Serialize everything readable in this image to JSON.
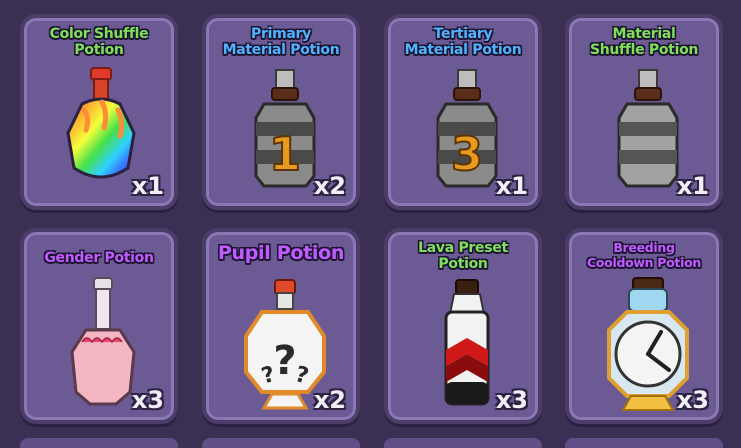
{
  "items": [
    {
      "name": "Color Shuffle Potion",
      "line1": "Color Shuffle",
      "line2": "Potion",
      "count": "x1",
      "color": "#7fe05a",
      "icon": "rainbow-potion-icon"
    },
    {
      "name": "Primary Material Potion",
      "line1": "Primary",
      "line2": "Material Potion",
      "count": "x2",
      "color": "#4fb3ff",
      "icon": "material-potion-1-icon",
      "number": "1"
    },
    {
      "name": "Tertiary Material Potion",
      "line1": "Tertiary",
      "line2": "Material Potion",
      "count": "x1",
      "color": "#4fb3ff",
      "icon": "material-potion-3-icon",
      "number": "3"
    },
    {
      "name": "Material Shuffle Potion",
      "line1": "Material",
      "line2": "Shuffle Potion",
      "count": "x1",
      "color": "#7fe05a",
      "icon": "material-shuffle-potion-icon"
    },
    {
      "name": "Gender Potion",
      "line1": "Gender Potion",
      "line2": "",
      "count": "x3",
      "color": "#c05cff",
      "icon": "pink-potion-icon"
    },
    {
      "name": "Pupil Potion",
      "line1": "Pupil Potion",
      "line2": "",
      "count": "x2",
      "color": "#c05cff",
      "icon": "question-potion-icon"
    },
    {
      "name": "Lava Preset Potion",
      "line1": "Lava Preset",
      "line2": "Potion",
      "count": "x3",
      "color": "#7fe05a",
      "icon": "lava-potion-icon"
    },
    {
      "name": "Breeding Cooldown Potion",
      "line1": "Breeding",
      "line2": "Cooldown Potion",
      "count": "x3",
      "color": "#c05cff",
      "icon": "clock-potion-icon"
    }
  ]
}
